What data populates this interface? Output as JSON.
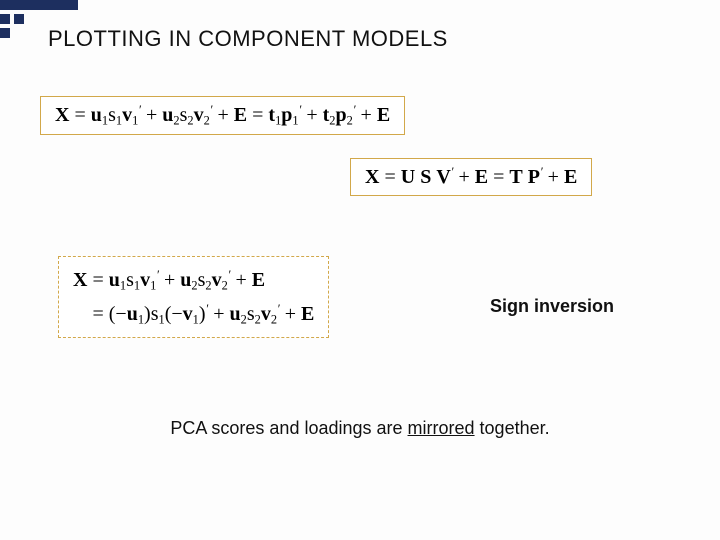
{
  "title": "PLOTTING IN COMPONENT MODELS",
  "label_sign": "Sign inversion",
  "footer_pre": "PCA scores and loadings are ",
  "footer_mid": "mirrored",
  "footer_post": " together.",
  "sym": {
    "X": "X",
    "u": "u",
    "s": "s",
    "v": "v",
    "t": "t",
    "p": "p",
    "E": "E",
    "U": "U",
    "S": "S",
    "V": "V",
    "T": "T",
    "P": "P",
    "eq": " = ",
    "plus": " + ",
    "one": "1",
    "two": "2",
    "prime": "′",
    "lpar": "(",
    "rpar": ")",
    "minus": "−"
  }
}
